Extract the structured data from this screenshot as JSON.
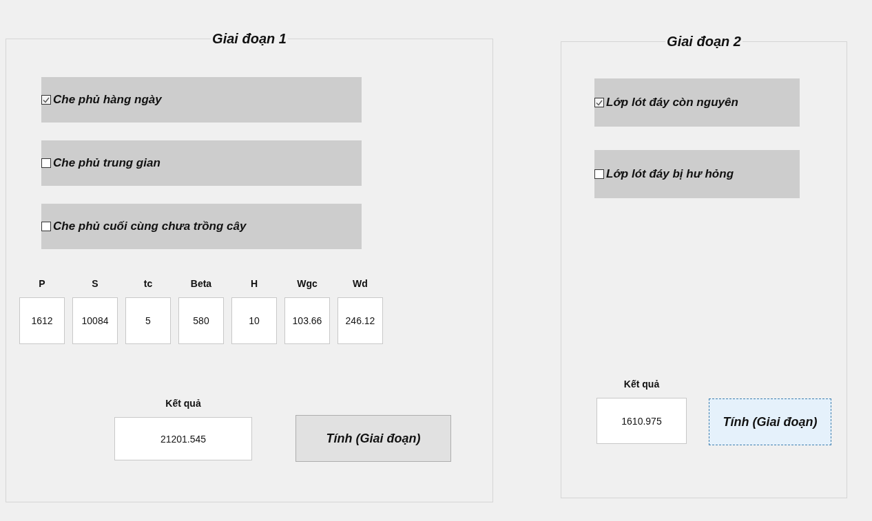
{
  "stages": [
    {
      "title": "Giai đoạn 1",
      "options": [
        {
          "label": "Che phủ hàng ngày",
          "checked": true
        },
        {
          "label": "Che phủ trung gian",
          "checked": false
        },
        {
          "label": "Che phủ cuối cùng chưa trồng cây",
          "checked": false
        }
      ],
      "inputs": [
        {
          "label": "P",
          "value": "1612"
        },
        {
          "label": "S",
          "value": "10084"
        },
        {
          "label": "tc",
          "value": "5"
        },
        {
          "label": "Beta",
          "value": "580"
        },
        {
          "label": "H",
          "value": "10"
        },
        {
          "label": "Wgc",
          "value": "103.66"
        },
        {
          "label": "Wd",
          "value": "246.12"
        }
      ],
      "result_label": "Kết quả",
      "result_value": "21201.545",
      "button": {
        "label": "Tính (Giai đoạn)",
        "focused": false
      }
    },
    {
      "title": "Giai đoạn 2",
      "options": [
        {
          "label": "Lớp lót đáy còn nguyên",
          "checked": true
        },
        {
          "label": "Lớp lót đáy bị hư hỏng",
          "checked": false
        }
      ],
      "result_label": "Kết quả",
      "result_value": "1610.975",
      "button": {
        "label": "Tính (Giai đoạn)",
        "focused": true
      }
    }
  ]
}
